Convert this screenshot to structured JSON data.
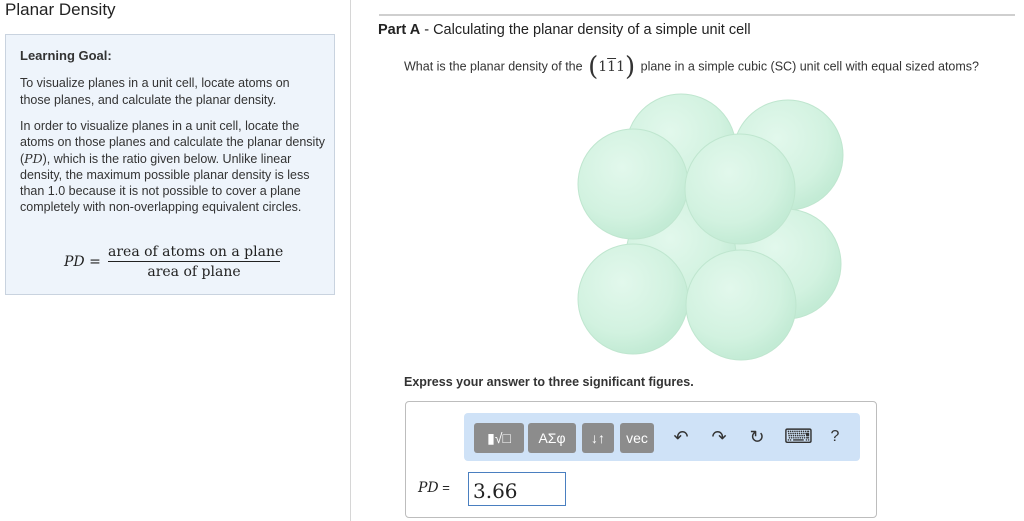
{
  "page": {
    "title": "Planar Density"
  },
  "learning_goal": {
    "heading": "Learning Goal:",
    "paragraph1": "To visualize planes in a unit cell, locate atoms on those planes, and calculate the planar density.",
    "paragraph2_before": "In order to visualize planes in a unit cell, locate the atoms on those planes and calculate the planar density (",
    "paragraph2_symbol": "PD",
    "paragraph2_after": "), which is the ratio given below. Unlike linear density, the maximum possible planar density is less than 1.0 because it is not possible to cover a plane completely with non-overlapping equivalent circles.",
    "formula": {
      "lhs": "PD =",
      "numerator": "area of atoms on a plane",
      "denominator": "area of plane"
    }
  },
  "part": {
    "label": "Part A",
    "separator": " - ",
    "title": "Calculating the planar density of a simple unit cell",
    "question_before": "What is the planar density of the",
    "miller_open": "(",
    "miller_digit1": "1",
    "miller_digit2": "1",
    "miller_digit3": "1",
    "miller_close": ")",
    "question_after": "plane in a simple cubic (SC) unit cell with equal sized atoms?",
    "express": "Express your answer to three significant figures."
  },
  "toolbar": {
    "templates_label": "▮√□",
    "greek_label": "ΑΣφ",
    "arrows_label": "↓↑",
    "vec_label": "vec",
    "undo_icon": "↶",
    "redo_icon": "↷",
    "reset_icon": "↻",
    "keyboard_icon": "⌨",
    "help_label": "?"
  },
  "answer": {
    "label": "PD",
    "equals": " = ",
    "value": "3.66"
  },
  "colors": {
    "atom_fill": "#d4f3e1",
    "goal_bg": "#eef4fb",
    "toolbar_bg": "#cfe2f7",
    "button_bg": "#8c8c8c",
    "input_border": "#4a7fc0"
  }
}
